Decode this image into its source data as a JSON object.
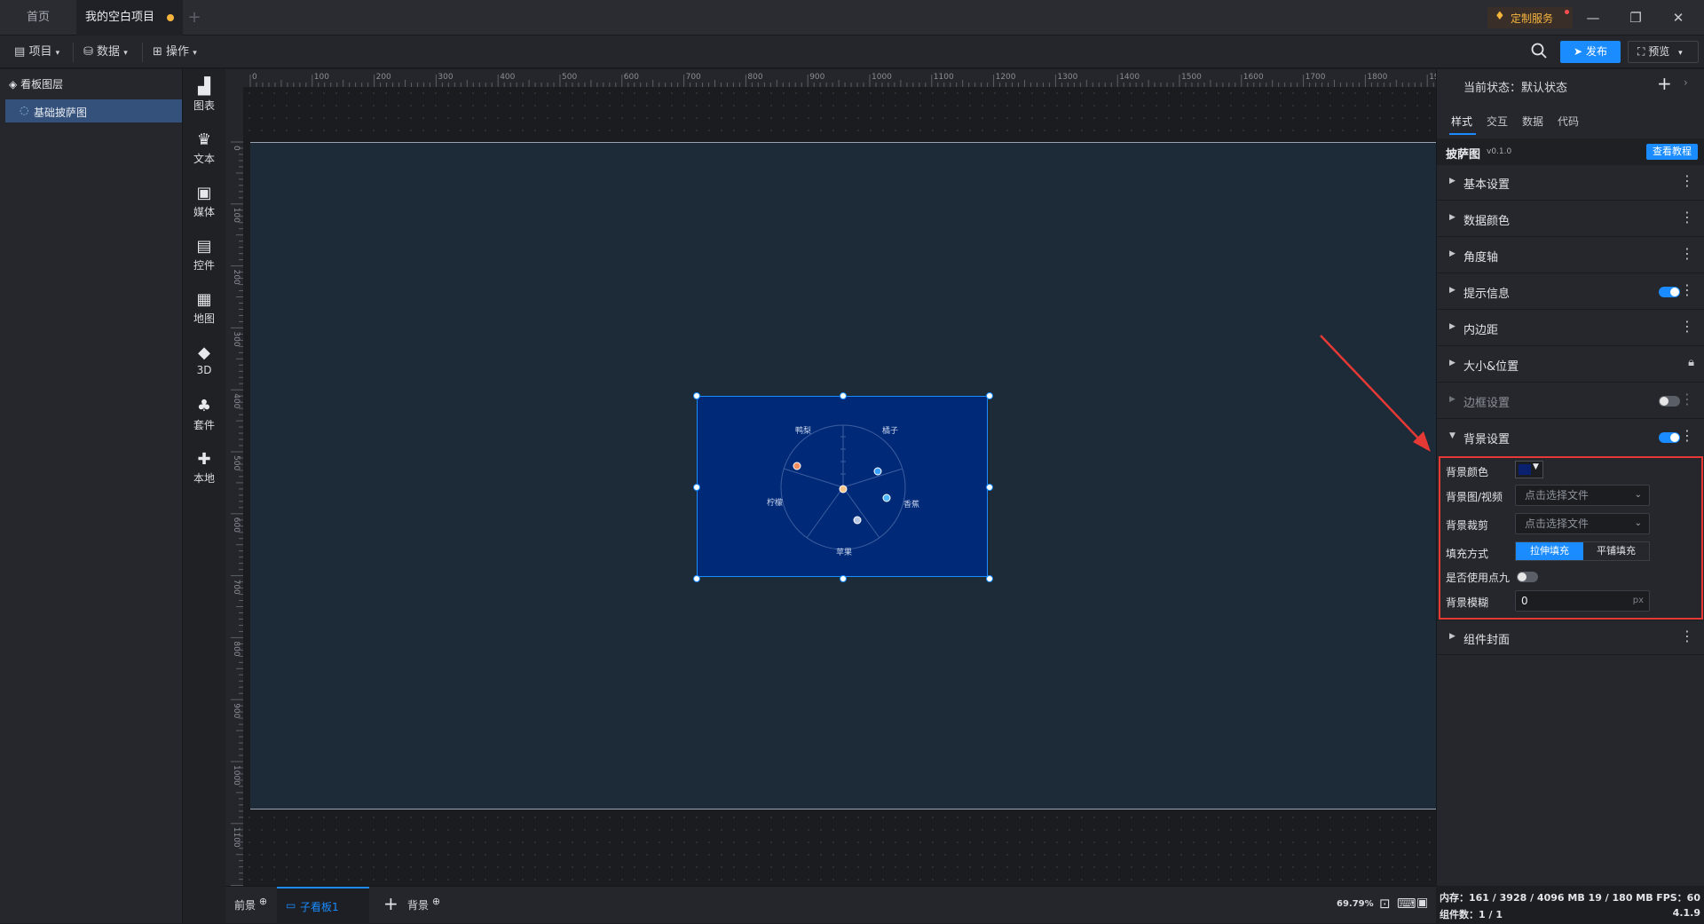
{
  "titlebar": {
    "tabs": [
      {
        "label": "首页"
      },
      {
        "label": "我的空白项目",
        "unsaved": true
      }
    ],
    "new_tab": "+",
    "custom_service": "定制服务",
    "win": {
      "minimize": "—",
      "restore": "❐",
      "close": "✕"
    }
  },
  "toolbar": {
    "menus": [
      {
        "label": "项目",
        "icon": "file-icon"
      },
      {
        "label": "数据",
        "icon": "database-icon"
      },
      {
        "label": "操作",
        "icon": "grid-icon"
      }
    ],
    "publish": "发布",
    "preview": "预览"
  },
  "layers": {
    "title": "看板图层",
    "items": [
      {
        "label": "基础披萨图",
        "selected": true
      }
    ]
  },
  "components": [
    {
      "label": "图表",
      "icon": "chart-icon"
    },
    {
      "label": "文本",
      "icon": "text-icon"
    },
    {
      "label": "媒体",
      "icon": "media-icon"
    },
    {
      "label": "控件",
      "icon": "widget-icon"
    },
    {
      "label": "地图",
      "icon": "map-icon"
    },
    {
      "label": "3D",
      "icon": "cube-icon"
    },
    {
      "label": "套件",
      "icon": "suite-icon"
    },
    {
      "label": "本地",
      "icon": "puzzle-icon"
    }
  ],
  "ruler": {
    "h_ticks": [
      "0",
      "100",
      "200",
      "300",
      "400",
      "500",
      "600",
      "700",
      "800",
      "900",
      "1000",
      "1100",
      "1200",
      "1300",
      "1400",
      "1500",
      "1600",
      "1700",
      "1800",
      "1900"
    ],
    "v_ticks": [
      "0",
      "100",
      "200",
      "300",
      "400",
      "500",
      "600",
      "700",
      "800",
      "900",
      "1000",
      "1100",
      "1200"
    ]
  },
  "pizza": {
    "labels": [
      "鸭梨",
      "橘子",
      "香蕉",
      "苹果",
      "柠檬"
    ],
    "bg_color": "#002a78"
  },
  "canvas_bottom": {
    "front": "前景",
    "board": "子看板1",
    "add": "+",
    "background": "背景",
    "zoom": "69.79%"
  },
  "right_panel": {
    "state_label": "当前状态：",
    "state_value": "默认状态",
    "tabs": [
      "样式",
      "交互",
      "数据",
      "代码"
    ],
    "component_name": "披萨图",
    "version": "v0.1.0",
    "tutorial": "查看教程",
    "sections": [
      {
        "label": "基本设置"
      },
      {
        "label": "数据颜色"
      },
      {
        "label": "角度轴"
      },
      {
        "label": "提示信息"
      },
      {
        "label": "内边距"
      },
      {
        "label": "大小&位置"
      },
      {
        "label": "边框设置"
      },
      {
        "label": "背景设置"
      }
    ],
    "bg": {
      "color_label": "背景颜色",
      "color_value": "#0a2170",
      "image_label": "背景图/视频",
      "image_placeholder": "点击选择文件",
      "crop_label": "背景裁剪",
      "crop_placeholder": "点击选择文件",
      "fill_label": "填充方式",
      "fill_stretch": "拉伸填充",
      "fill_tile": "平铺填充",
      "nine_label": "是否使用点九",
      "blur_label": "背景模糊",
      "blur_value": "0",
      "blur_unit": "px"
    },
    "cover": "组件封面"
  },
  "status": {
    "memory": "内存：161 / 3928 / 4096 MB   19 / 180 MB",
    "fps": "FPS：60",
    "count": "组件数：1 / 1",
    "version": "4.1.9"
  },
  "colors": {
    "accent": "#1a8cff",
    "annotation": "#e53935"
  }
}
